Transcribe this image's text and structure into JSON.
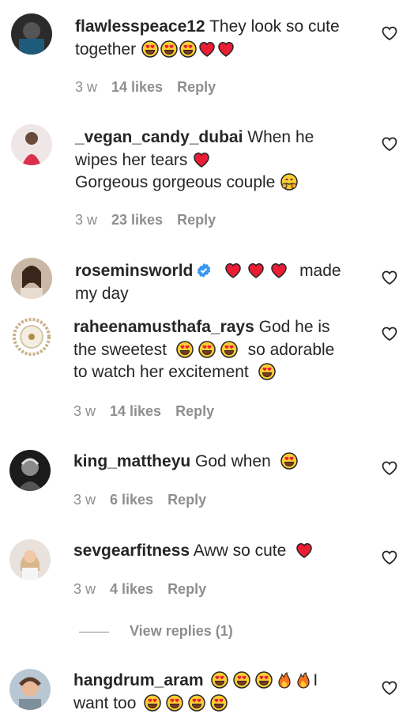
{
  "comments": [
    {
      "username": "flawlesspeace12",
      "line1": " They look so cute",
      "line2": "together",
      "line3": "",
      "age": "3 w",
      "likes": "14 likes",
      "reply": "Reply"
    },
    {
      "username": "_vegan_candy_dubai",
      "line1": " When he",
      "line2": "wipes her tears",
      "line3": "Gorgeous gorgeous couple",
      "age": "3 w",
      "likes": "23 likes",
      "reply": "Reply"
    },
    {
      "username": "roseminsworld",
      "line1": "made",
      "line2": "my day",
      "line3": ""
    },
    {
      "username": "raheenamusthafa_rays",
      "line1": " God he is",
      "line2": "the sweetest",
      "line2b": "so adorable",
      "line3": "to watch her excitement",
      "age": "3 w",
      "likes": "14 likes",
      "reply": "Reply"
    },
    {
      "username": "king_mattheyu",
      "line1": " God when",
      "age": "3 w",
      "likes": "6 likes",
      "reply": "Reply"
    },
    {
      "username": "sevgearfitness",
      "line1": " Aww so cute",
      "age": "3 w",
      "likes": "4 likes",
      "reply": "Reply"
    },
    {
      "username": "hangdrum_aram",
      "line1": "I",
      "line2": "want too"
    }
  ],
  "view_replies": "View replies (1)",
  "colors": {
    "text": "#262626",
    "muted": "#8e8e8e",
    "heart_red": "#ed1c35",
    "emoji_yellow": "#ffcc33",
    "verified_blue": "#3897f0"
  },
  "icons": {
    "like": "heart-outline-icon",
    "verified": "verified-badge-icon"
  }
}
